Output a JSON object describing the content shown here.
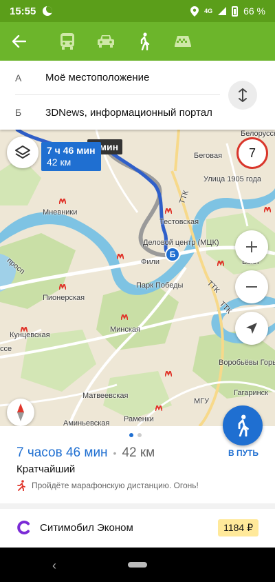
{
  "status_bar": {
    "time": "15:55",
    "network": "4G",
    "battery": "66 %"
  },
  "toolbar": {
    "back_icon": "arrow-left-icon",
    "modes": [
      {
        "icon": "bus-icon",
        "name": "transit"
      },
      {
        "icon": "car-icon",
        "name": "car"
      },
      {
        "icon": "pedestrian-icon",
        "name": "walk"
      },
      {
        "icon": "taxi-icon",
        "name": "taxi"
      }
    ]
  },
  "route": {
    "from_letter": "А",
    "from": "Моё местоположение",
    "to_letter": "Б",
    "to": "3DNews, информационный портал"
  },
  "map": {
    "main_time": "7 ч 46 мин",
    "main_distance": "42 км",
    "alt_time": "4 мин",
    "speed_limit": "7",
    "destination_marker": "Б",
    "labels": {
      "belorusskaya": "Белорусская",
      "begovaya": "Беговая",
      "street_1905": "Улица 1905 года",
      "mnevniki": "Мневники",
      "ttk_1": "ТТК",
      "testovskaya": "Тестовская",
      "delovoy": "Деловой центр (МЦК)",
      "fili": "Фили",
      "vystavochnaya": "Выст",
      "park_pobedy": "Парк Победы",
      "ttk_2": "ТТК",
      "ttk_3": "ТТК",
      "pionerskaya": "Пионерская",
      "minskaya": "Минская",
      "kuntsevskaya": "Кунцевская",
      "sse": "ссе",
      "vorobyovy": "Воробьёвы Горы",
      "gagarinsk": "Гагаринск",
      "mgu": "МГУ",
      "matveevskaya": "Матвеевская",
      "ramenki": "Раменки",
      "aminyevskaya": "Аминьевская",
      "prosp": "просп"
    }
  },
  "summary": {
    "duration": "7 часов 46 мин",
    "separator": "•",
    "distance": "42 км",
    "route_type": "Кратчайший",
    "marathon_note": "Пройдёте марафонскую дистанцию. Огонь!",
    "go_label": "В ПУТЬ"
  },
  "taxi": {
    "name": "Ситимобил Эконом",
    "price": "1184 ₽"
  },
  "colors": {
    "statusbar": "#5b9e1a",
    "toolbar": "#6cb52b",
    "accent_blue": "#1f6fd1",
    "speed_red": "#d9362b",
    "price_bg": "#ffe99a",
    "metro_red": "#e0352b"
  }
}
